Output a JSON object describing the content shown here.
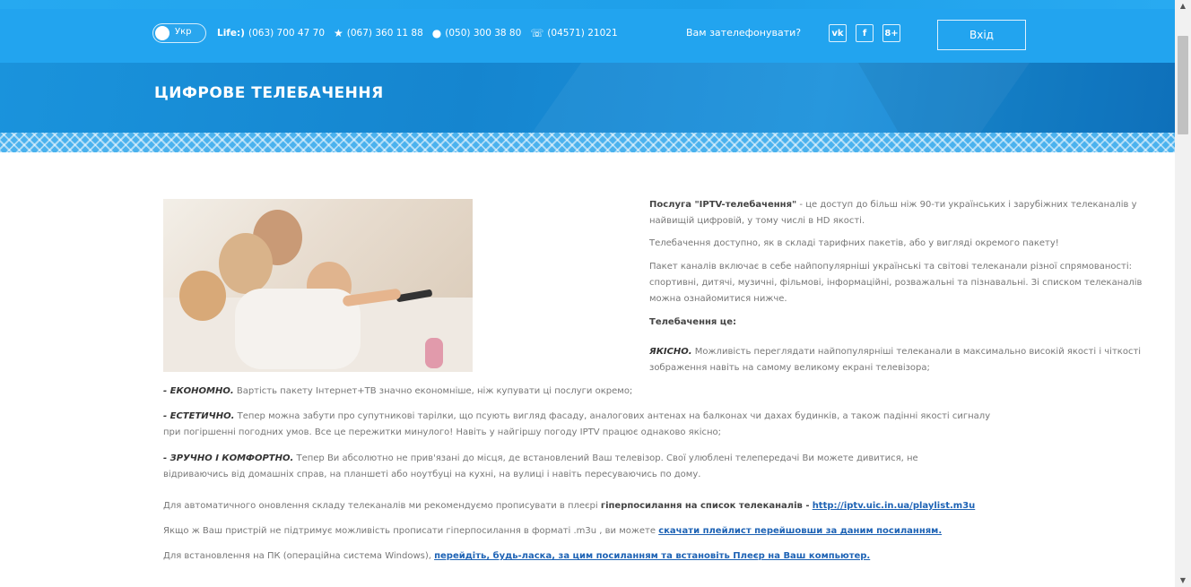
{
  "header": {
    "lang": "Укр",
    "phone_life_prefix": "Life:)",
    "phone_life": "(063) 700 47 70",
    "phone_ks": "(067) 360 11 88",
    "phone_mts": "(050) 300 38 80",
    "phone_city": "(04571) 21021",
    "callback": "Вам зателефонувати?",
    "social": {
      "vk": "vk",
      "fb": "f",
      "gplus": "8+"
    },
    "login": "Вхід"
  },
  "banner": {
    "title": "ЦИФРОВЕ ТЕЛЕБАЧЕННЯ"
  },
  "content": {
    "intro_bold": "Послуга \"IPTV-телебачення\"",
    "intro_rest_1": "- це доступ до більш ніж 90-ти українських і зарубіжних телеканалів у",
    "intro_rest_2": "найвищій цифровій, у тому числі в HD якості.",
    "p2": "Телебачення доступно, як в складі тарифних пакетів, або у вигляді окремого пакету!",
    "p3_1": "Пакет каналів включає в себе найпопулярніші українські та світові телеканали різної спрямованості:",
    "p3_2": "спортивні, дитячі, музичні, фільмові, інформаційні, розважальні та пізнавальні. Зі списком телеканалів",
    "p3_3": "можна ознайомитися нижче.",
    "heading": "Телебачення це:",
    "q1_label": "ЯКІСНО.",
    "q1_text_1": "Можливість переглядати найпопулярніші телеканали в максимально високій якості і чіткості",
    "q1_text_2": "зображення навіть на самому великому екрані телевізора;",
    "q2_label": "- ЕКОНОМНО.",
    "q2_text": "Вартість пакету Інтернет+ТВ значно економніше, ніж купувати ці послуги окремо;",
    "q3_label": "- ЕСТЕТИЧНО.",
    "q3_text_1": "Тепер можна забути про супутникові тарілки, що псують вигляд фасаду, аналогових антенах на балконах чи дахах будинків, а також падінні якості сигналу",
    "q3_text_2": "при погіршенні погодних умов. Все це пережитки минулого! Навіть у найгіршу погоду IPTV працює однаково якісно;",
    "q4_label": "- ЗРУЧНО І КОМФОРТНО.",
    "q4_text_1": "Тепер Ви абсолютно не прив'язані до місця, де встановлений Ваш телевізор. Свої улюблені телепередачі Ви можете дивитися, не",
    "q4_text_2": "відриваючись від домашніх справ, на планшеті або ноутбуці на кухні, на вулиці і навіть пересуваючись по дому.",
    "auto_text": "Для автоматичного оновлення складу телеканалів ми рекомендуємо прописувати в плеєрі",
    "auto_bold": "гіперпосилання на список телеканалів -",
    "auto_link": "http://iptv.uic.in.ua/playlist.m3u",
    "m3u_text": "Якщо ж Ваш пристрій не підтримує можливість прописати гіперпосилання в форматі .m3u , ви можете",
    "m3u_link": "скачати плейлист перейшовши за даним посиланням.",
    "pc_text": "Для встановлення на ПК (операційна система Windows),",
    "pc_link": "перейдіть, будь-ласка, за цим посиланням та встановіть Плеєр на Ваш компьютер."
  }
}
